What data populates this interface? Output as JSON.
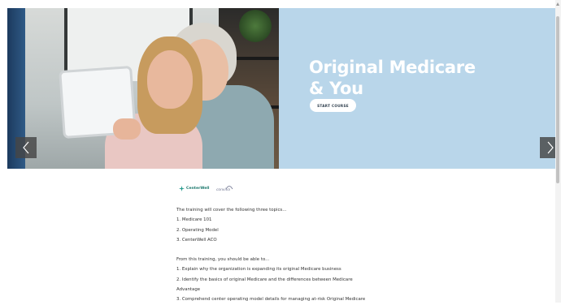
{
  "hero": {
    "title": "Original Medicare\n& You",
    "start_button_label": "START COURSE",
    "accent_color": "#b9d6ea",
    "prev_icon": "chevron-left-icon",
    "next_icon": "chevron-right-icon"
  },
  "logos": {
    "centerwell": "CenterWell",
    "conviva": "conviva"
  },
  "content": {
    "intro": "The training will cover the following three topics...",
    "topics": [
      "1. Medicare 101",
      "2. Operating Model",
      "3. CenterWell ACO"
    ],
    "objectives_intro": "From this training, you should be able to...",
    "objectives_lines": [
      "1. Explain why the organization is expanding its original Medicare business",
      "2. Identify the basics of original Medicare and the differences between Medicare",
      "Advantage",
      "3. Comprehend center operating model details for managing at-risk Original Medicare"
    ]
  }
}
